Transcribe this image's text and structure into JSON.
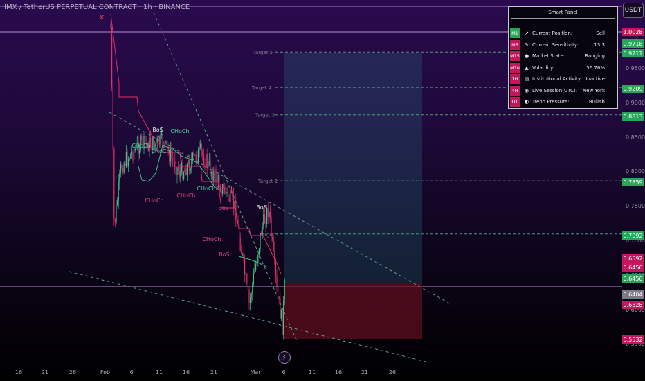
{
  "header": {
    "title": "IMX / TetherUS PERPETUAL CONTRACT · 1h · BINANCE",
    "currency_badge": "USDT"
  },
  "chart_data": {
    "type": "candlestick",
    "ylim": [
      0.55,
      1.0
    ],
    "x_ticks": [
      "16",
      "21",
      "26",
      "Feb",
      "6",
      "11",
      "16",
      "21",
      "Mar",
      "6",
      "11",
      "16",
      "21",
      "26"
    ],
    "y_ticks": [
      "0.9500",
      "0.9000",
      "0.8500",
      "0.8000",
      "0.7500",
      "0.7000",
      "0.6500",
      "0.6000",
      "0.5500"
    ],
    "targets": [
      {
        "label": "Target 5",
        "value": 0.9718
      },
      {
        "label": "Target 4",
        "value": 0.9209
      },
      {
        "label": "Target 3",
        "value": 0.8813
      },
      {
        "label": "Target 2",
        "value": 0.7859
      },
      {
        "label": "Target 1",
        "value": 0.7092
      }
    ],
    "markers": [
      {
        "text": "BoS",
        "color": "#e0e0ea"
      },
      {
        "text": "CHoCh",
        "color": "#4fd1a0"
      },
      {
        "text": "CHoCh",
        "color": "#4fd1a0"
      },
      {
        "text": "CHoCh",
        "color": "#4fd1a0"
      },
      {
        "text": "CHoCh",
        "color": "#e0457a"
      },
      {
        "text": "CHoCh",
        "color": "#e0457a"
      },
      {
        "text": "CHoCh",
        "color": "#4fd1a0"
      },
      {
        "text": "CHoCh",
        "color": "#e0457a"
      },
      {
        "text": "BoS",
        "color": "#e0e0ea"
      },
      {
        "text": "BoS",
        "color": "#e0457a"
      },
      {
        "text": "CHoCh",
        "color": "#e0457a"
      },
      {
        "text": "BoS",
        "color": "#e0457a"
      },
      {
        "text": "x",
        "color": "#ff3b6b"
      }
    ],
    "price_labels": [
      {
        "text": "1.0028",
        "color": "#c2185b"
      },
      {
        "text": "0.9718",
        "color": "#26a65b"
      },
      {
        "text": "0.9711",
        "color": "#26a65b"
      },
      {
        "text": "0.9209",
        "color": "#26a65b"
      },
      {
        "text": "0.8813",
        "color": "#26a65b"
      },
      {
        "text": "0.7859",
        "color": "#26a65b"
      },
      {
        "text": "0.7092",
        "color": "#26a65b"
      },
      {
        "text": "0.6592",
        "color": "#c2185b"
      },
      {
        "text": "0.6456",
        "color": "#c2185b"
      },
      {
        "text": "0.6456",
        "color": "#26a65b"
      },
      {
        "text": "0.6404",
        "color": "#7a7a86"
      },
      {
        "text": "0.6328",
        "color": "#c2185b"
      },
      {
        "text": "0.5532",
        "color": "#c2185b"
      }
    ]
  },
  "smart_panel": {
    "title": "Smart Panel",
    "rows": [
      {
        "tf": "M1",
        "tf_color": "#26a65b",
        "icon": "↗",
        "label": "Current Position:",
        "value": "Sell"
      },
      {
        "tf": "M5",
        "tf_color": "#c2185b",
        "icon": "✎",
        "label": "Current Sensitivity:",
        "value": "13.3"
      },
      {
        "tf": "M15",
        "tf_color": "#c2185b",
        "icon": "●",
        "label": "Market State:",
        "value": "Ranging"
      },
      {
        "tf": "M30",
        "tf_color": "#c2185b",
        "icon": "▲",
        "label": "Volatility:",
        "value": "36.76%"
      },
      {
        "tf": "1H",
        "tf_color": "#c2185b",
        "icon": "▤",
        "label": "Institutional Activity:",
        "value": "Inactive"
      },
      {
        "tf": "4H",
        "tf_color": "#c2185b",
        "icon": "◉",
        "label": "Live Session(UTC):",
        "value": "New York"
      },
      {
        "tf": "D1",
        "tf_color": "#c2185b",
        "icon": "◐",
        "label": "Trend Pressure:",
        "value": "Bullish"
      }
    ]
  },
  "footer": {
    "bolt_icon": "⚡"
  }
}
